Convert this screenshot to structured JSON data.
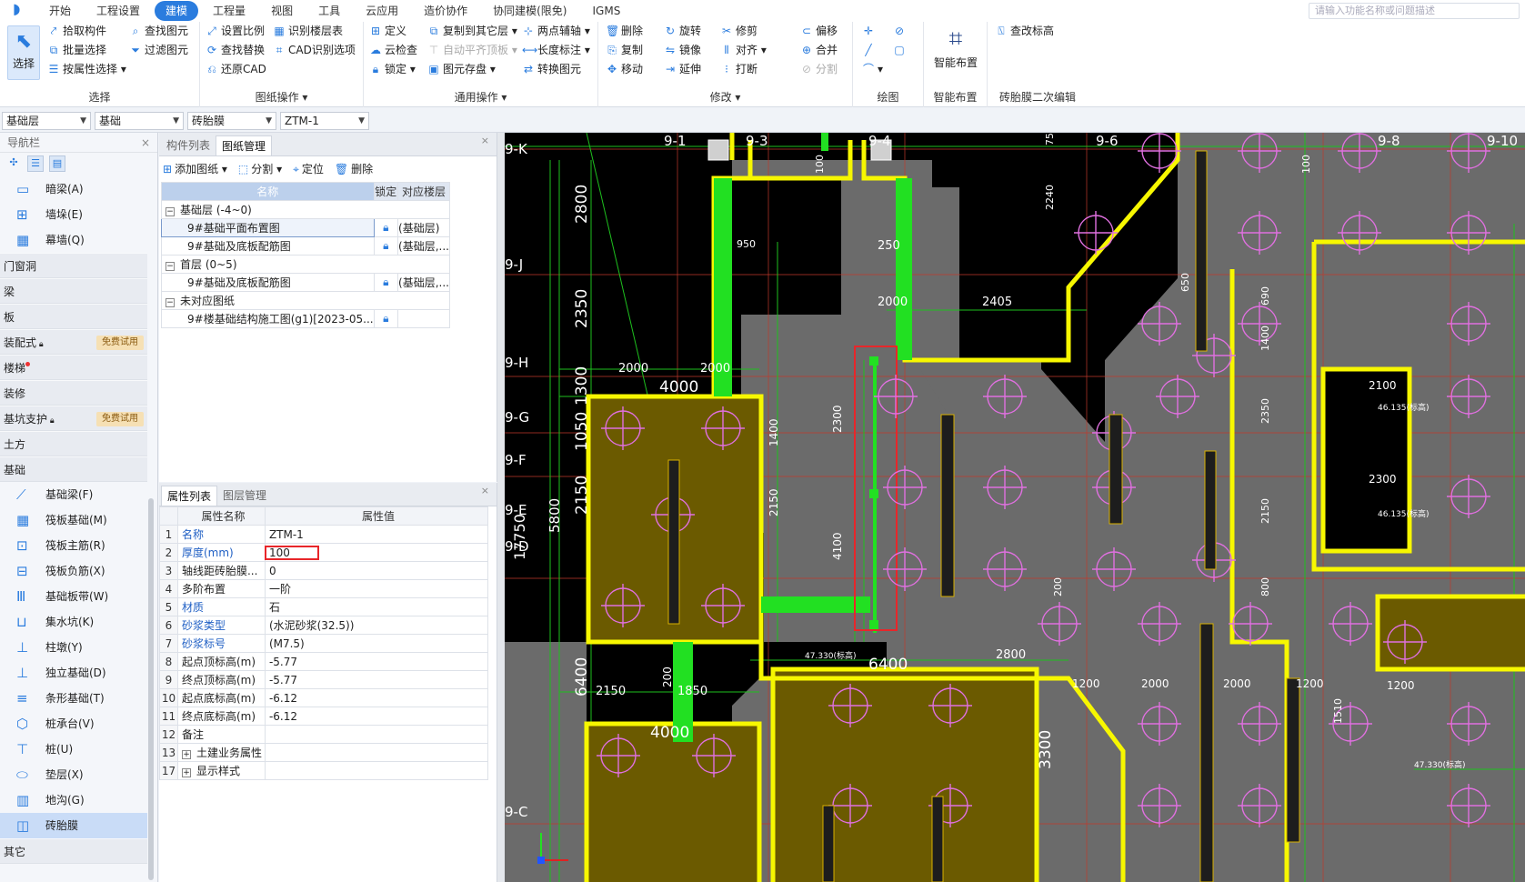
{
  "menu": {
    "tabs": [
      "开始",
      "工程设置",
      "建模",
      "工程量",
      "视图",
      "工具",
      "云应用",
      "造价协作",
      "协同建模(限免)",
      "IGMS"
    ],
    "active_index": 2,
    "search_placeholder": "请输入功能名称或问题描述"
  },
  "ribbon": {
    "select_group": {
      "title": "选择",
      "big_button": "选择",
      "items": [
        "拾取构件",
        "批量选择",
        "按属性选择",
        "查找图元",
        "过滤图元"
      ]
    },
    "drawing_group": {
      "title": "图纸操作",
      "items": [
        "设置比例",
        "查找替换",
        "还原CAD",
        "识别楼层表",
        "CAD识别选项"
      ]
    },
    "common_group": {
      "title": "通用操作",
      "items": [
        "定义",
        "云检查",
        "锁定",
        "复制到其它层",
        "自动平齐顶板",
        "图元存盘",
        "两点辅轴",
        "长度标注",
        "转换图元"
      ]
    },
    "modify_group": {
      "title": "修改",
      "items": [
        "删除",
        "复制",
        "移动",
        "旋转",
        "镜像",
        "延伸",
        "修剪",
        "对齐",
        "打断",
        "偏移",
        "合并",
        "分割"
      ]
    },
    "draw_group": {
      "title": "绘图"
    },
    "smart_group": {
      "title": "智能布置",
      "big_button": "智能布置"
    },
    "brick_group": {
      "title": "砖胎膜二次编辑",
      "items": [
        "查改标高"
      ]
    }
  },
  "layerbar": {
    "floor": "基础层",
    "category": "基础",
    "type": "砖胎膜",
    "component": "ZTM-1"
  },
  "nav": {
    "title": "导航栏",
    "items": [
      {
        "label": "暗梁(A)",
        "kind": "sub",
        "icon": "▭"
      },
      {
        "label": "墙垛(E)",
        "kind": "sub",
        "icon": "⊞"
      },
      {
        "label": "幕墙(Q)",
        "kind": "sub",
        "icon": "▦"
      },
      {
        "label": "门窗洞",
        "kind": "cat"
      },
      {
        "label": "梁",
        "kind": "cat"
      },
      {
        "label": "板",
        "kind": "cat"
      },
      {
        "label": "装配式",
        "kind": "cat",
        "badge": "免费试用",
        "lock": true
      },
      {
        "label": "楼梯",
        "kind": "cat",
        "dot": true
      },
      {
        "label": "装修",
        "kind": "cat"
      },
      {
        "label": "基坑支护",
        "kind": "cat",
        "badge": "免费试用",
        "lock": true
      },
      {
        "label": "土方",
        "kind": "cat"
      },
      {
        "label": "基础",
        "kind": "cat"
      },
      {
        "label": "基础梁(F)",
        "kind": "sub",
        "icon": "⟋"
      },
      {
        "label": "筏板基础(M)",
        "kind": "sub",
        "icon": "▦"
      },
      {
        "label": "筏板主筋(R)",
        "kind": "sub",
        "icon": "⊡"
      },
      {
        "label": "筏板负筋(X)",
        "kind": "sub",
        "icon": "⊟"
      },
      {
        "label": "基础板带(W)",
        "kind": "sub",
        "icon": "Ⅲ"
      },
      {
        "label": "集水坑(K)",
        "kind": "sub",
        "icon": "⊔"
      },
      {
        "label": "柱墩(Y)",
        "kind": "sub",
        "icon": "⊥"
      },
      {
        "label": "独立基础(D)",
        "kind": "sub",
        "icon": "⊥"
      },
      {
        "label": "条形基础(T)",
        "kind": "sub",
        "icon": "≡"
      },
      {
        "label": "桩承台(V)",
        "kind": "sub",
        "icon": "⬡"
      },
      {
        "label": "桩(U)",
        "kind": "sub",
        "icon": "⊤"
      },
      {
        "label": "垫层(X)",
        "kind": "sub",
        "icon": "⬭"
      },
      {
        "label": "地沟(G)",
        "kind": "sub",
        "icon": "▥"
      },
      {
        "label": "砖胎膜",
        "kind": "sub",
        "icon": "◫",
        "selected": true
      },
      {
        "label": "其它",
        "kind": "cat"
      }
    ]
  },
  "drawing_panel": {
    "tabs": [
      "构件列表",
      "图纸管理"
    ],
    "active_tab": 1,
    "tools": [
      "添加图纸",
      "分割",
      "定位",
      "删除"
    ],
    "columns": [
      "名称",
      "锁定",
      "对应楼层"
    ],
    "rows": [
      {
        "group": true,
        "label": "基础层 (-4~0)"
      },
      {
        "label": "9#基础平面布置图",
        "floor": "(基础层)",
        "selected": true
      },
      {
        "label": "9#基础及底板配筋图",
        "floor": "(基础层,..."
      },
      {
        "group": true,
        "label": "首层 (0~5)"
      },
      {
        "label": "9#基础及底板配筋图",
        "floor": "(基础层,..."
      },
      {
        "group": true,
        "label": "未对应图纸"
      },
      {
        "label": "9#楼基础结构施工图(g1)[2023-05...",
        "floor": ""
      }
    ]
  },
  "property_panel": {
    "tabs": [
      "属性列表",
      "图层管理"
    ],
    "active_tab": 0,
    "columns": [
      "属性名称",
      "属性值"
    ],
    "rows": [
      {
        "idx": "1",
        "name": "名称",
        "value": "ZTM-1",
        "blue": true
      },
      {
        "idx": "2",
        "name": "厚度(mm)",
        "value": "100",
        "blue": true,
        "highlight": true
      },
      {
        "idx": "3",
        "name": "轴线距砖胎膜...",
        "value": "0"
      },
      {
        "idx": "4",
        "name": "多阶布置",
        "value": "一阶"
      },
      {
        "idx": "5",
        "name": "材质",
        "value": "石",
        "blue": true
      },
      {
        "idx": "6",
        "name": "砂浆类型",
        "value": "(水泥砂浆(32.5))",
        "blue": true
      },
      {
        "idx": "7",
        "name": "砂浆标号",
        "value": "(M7.5)",
        "blue": true
      },
      {
        "idx": "8",
        "name": "起点顶标高(m)",
        "value": "-5.77"
      },
      {
        "idx": "9",
        "name": "终点顶标高(m)",
        "value": "-5.77"
      },
      {
        "idx": "10",
        "name": "起点底标高(m)",
        "value": "-6.12"
      },
      {
        "idx": "11",
        "name": "终点底标高(m)",
        "value": "-6.12"
      },
      {
        "idx": "12",
        "name": "备注",
        "value": ""
      },
      {
        "idx": "13",
        "name": "土建业务属性",
        "value": "",
        "expand": true
      },
      {
        "idx": "17",
        "name": "显示样式",
        "value": "",
        "expand": true
      }
    ]
  },
  "canvas": {
    "axis_labels": [
      "9-1",
      "9-3",
      "9-4",
      "9-6",
      "9-8",
      "9-10",
      "9-K",
      "9-J",
      "9-H",
      "9-G",
      "9-F",
      "9-E",
      "9-D",
      "9-C"
    ],
    "dims": [
      "2800",
      "2350",
      "1300",
      "1050",
      "2150",
      "5800",
      "17750",
      "6400",
      "4000",
      "2000",
      "2000",
      "250",
      "1400",
      "2300",
      "4100",
      "2150",
      "2405",
      "2000",
      "3300",
      "6400",
      "2800",
      "1850",
      "2150",
      "4000",
      "200",
      "750",
      "2240",
      "100",
      "100",
      "650",
      "690",
      "1400",
      "2350",
      "2150",
      "800",
      "200",
      "2100",
      "2300",
      "1200",
      "2000",
      "2000",
      "1200",
      "1200",
      "1510",
      "950"
    ],
    "elevations": [
      "47.330(标高)",
      "46.135(标高)",
      "46.135(标高)",
      "47.330(标高)"
    ],
    "colors": {
      "bg": "#000000",
      "slab": "#6b6b6b",
      "wall": "#f7f700",
      "pit": "#6b5a00",
      "brick": "#22e022",
      "dim": "#1ec01e",
      "sel": "#e8262a"
    }
  }
}
